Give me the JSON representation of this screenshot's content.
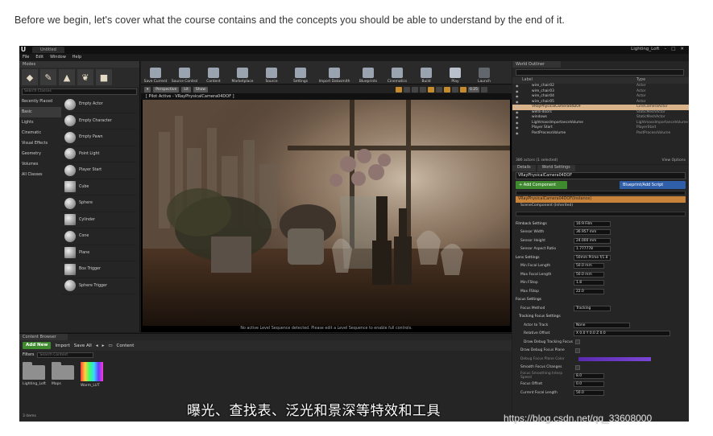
{
  "intro_text": "Before we begin, let's cover what the course contains and the concepts you should be able to understand by the end of it.",
  "app": {
    "titlebar": {
      "tab": "Untitled",
      "project": "Lighting_Loft"
    },
    "menu": [
      "File",
      "Edit",
      "Window",
      "Help"
    ]
  },
  "modes": {
    "tab": "Modes",
    "search_placeholder": "Search Classes",
    "categories": [
      "Recently Placed",
      "Basic",
      "Lights",
      "Cinematic",
      "Visual Effects",
      "Geometry",
      "Volumes",
      "All Classes"
    ],
    "selected_category": "Basic",
    "items": [
      "Empty Actor",
      "Empty Character",
      "Empty Pawn",
      "Point Light",
      "Player Start",
      "Cube",
      "Sphere",
      "Cylinder",
      "Cone",
      "Plane",
      "Box Trigger",
      "Sphere Trigger"
    ]
  },
  "toolbar": {
    "buttons": [
      "Save Current",
      "Source Control",
      "Content",
      "Marketplace",
      "Source",
      "Settings",
      "Import Datasmith",
      "Blueprints",
      "Cinematics",
      "Build",
      "Play",
      "Launch"
    ]
  },
  "viewport": {
    "perspective": "Perspective",
    "lit": "Lit",
    "show": "Show",
    "camera_speed": "0.25",
    "pilot": "[ Pilot Active - VRayPhysicalCamera04DOF ]",
    "message": "No active Level Sequence detected. Please edit a Level Sequence to enable full controls."
  },
  "outliner": {
    "tab": "World Outliner",
    "col_label": "Label",
    "col_type": "Type",
    "rows": [
      {
        "label": "wire_chair02",
        "type": "Actor"
      },
      {
        "label": "wire_chair03",
        "type": "Actor"
      },
      {
        "label": "wire_chair04",
        "type": "Actor"
      },
      {
        "label": "wire_chair05",
        "type": "Actor"
      },
      {
        "label": "VRayPhysicalCamera04DOF",
        "type": "CineCameraActor"
      },
      {
        "label": "wells-doors",
        "type": "StaticMeshActor"
      },
      {
        "label": "windows",
        "type": "StaticMeshActor"
      },
      {
        "label": "LightmassImportanceVolume",
        "type": "LightmassImportanceVolume"
      },
      {
        "label": "Player Start",
        "type": "PlayerStart"
      },
      {
        "label": "PostProcessVolume",
        "type": "PostProcessVolume"
      }
    ],
    "selected_index": 4,
    "footer_left": "386 actors (1 selected)",
    "footer_right": "View Options"
  },
  "details": {
    "tab_details": "Details",
    "tab_world": "World Settings",
    "name": "VRayPhysicalCamera04DOF",
    "add_component": "+ Add Component",
    "blueprint": "Blueprint/Add Script",
    "component_selected": "VRayPhysicalCamera04DOF(Instance)",
    "component_child": "SceneComponent (Inherited)",
    "props": [
      {
        "name": "Filmback Settings",
        "value": "16:9 Film",
        "header": true
      },
      {
        "name": "Sensor Width",
        "value": "36.957 mm"
      },
      {
        "name": "Sensor Height",
        "value": "24.000 mm"
      },
      {
        "name": "Sensor Aspect Ratio",
        "value": "1.777778"
      },
      {
        "name": "Lens Settings",
        "value": "50mm Prime f/1.8",
        "header": true
      },
      {
        "name": "Min Focal Length",
        "value": "50.0 mm"
      },
      {
        "name": "Max Focal Length",
        "value": "50.0 mm"
      },
      {
        "name": "Min FStop",
        "value": "1.8"
      },
      {
        "name": "Max FStop",
        "value": "22.0"
      },
      {
        "name": "Focus Settings",
        "value": "",
        "header": true
      },
      {
        "name": "Focus Method",
        "value": "Tracking"
      },
      {
        "name": "Tracking Focus Settings",
        "value": "",
        "header": true
      },
      {
        "name": "Actor to Track",
        "value": "None"
      },
      {
        "name": "Relative Offset",
        "value": "X 0.0  Y 0.0  Z 0.0"
      },
      {
        "name": "Draw Debug Tracking Focus",
        "value": ""
      },
      {
        "name": "Draw Debug Focus Plane",
        "value": ""
      },
      {
        "name": "Debug Focus Plane Color",
        "value": ""
      },
      {
        "name": "Smooth Focus Changes",
        "value": ""
      },
      {
        "name": "Focus Smoothing Interp Speed",
        "value": "8.0"
      },
      {
        "name": "Focus Offset",
        "value": "0.0"
      },
      {
        "name": "Current Focal Length",
        "value": "50.0"
      }
    ]
  },
  "content_browser": {
    "tab": "Content Browser",
    "add_new": "Add New",
    "import": "Import",
    "save_all": "Save All",
    "path": "Content",
    "filters": "Filters",
    "search_placeholder": "Search Content",
    "assets": [
      "Lighting_Loft",
      "Maps",
      "Warm_LUT"
    ],
    "footer": "3 items"
  },
  "subtitle": "曝光、查找表、泛光和景深等特效和工具",
  "watermark": "https://blog.csdn.net/qq_33608000"
}
